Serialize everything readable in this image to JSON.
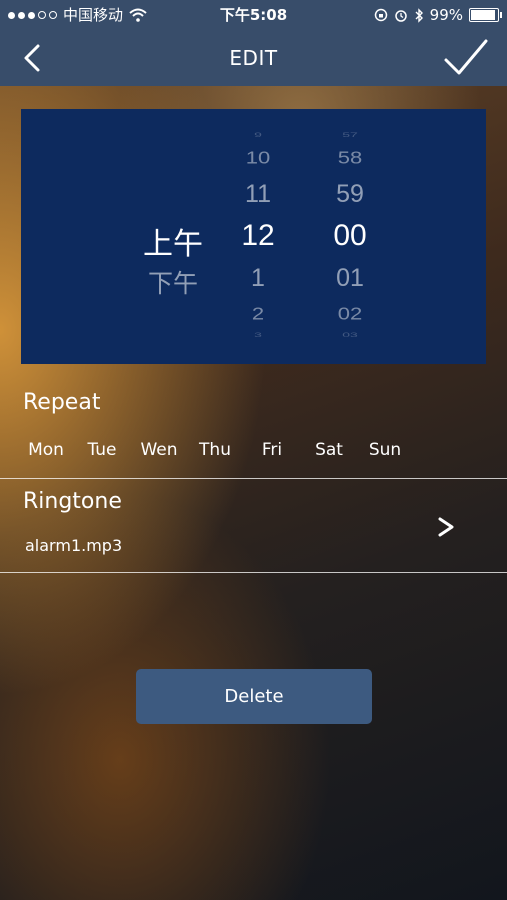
{
  "status_bar": {
    "carrier": "中国移动",
    "time": "下午5:08",
    "battery_text": "99%",
    "battery_level": 0.99,
    "icons": [
      "signal-dots-icon",
      "wifi-icon",
      "rotation-lock-icon",
      "alarm-icon",
      "bluetooth-icon",
      "battery-icon"
    ]
  },
  "nav": {
    "title": "EDIT",
    "back_icon": "chevron-left-icon",
    "confirm_icon": "checkmark-icon"
  },
  "picker": {
    "ampm": [
      "上午",
      "下午"
    ],
    "hours": [
      "9",
      "10",
      "11",
      "12",
      "1",
      "2",
      "3"
    ],
    "minutes": [
      "57",
      "58",
      "59",
      "00",
      "01",
      "02",
      "03"
    ],
    "selected": {
      "ampm": "上午",
      "hour": "12",
      "minute": "00"
    }
  },
  "repeat": {
    "title": "Repeat",
    "days": [
      "Mon",
      "Tue",
      "Wen",
      "Thu",
      "Fri",
      "Sat",
      "Sun"
    ]
  },
  "ringtone": {
    "title": "Ringtone",
    "file": "alarm1.mp3",
    "chevron": ">"
  },
  "delete_label": "Delete",
  "colors": {
    "bar": "#384d6a",
    "picker_bg": "#0d2a5e",
    "button": "#3d5a80"
  }
}
